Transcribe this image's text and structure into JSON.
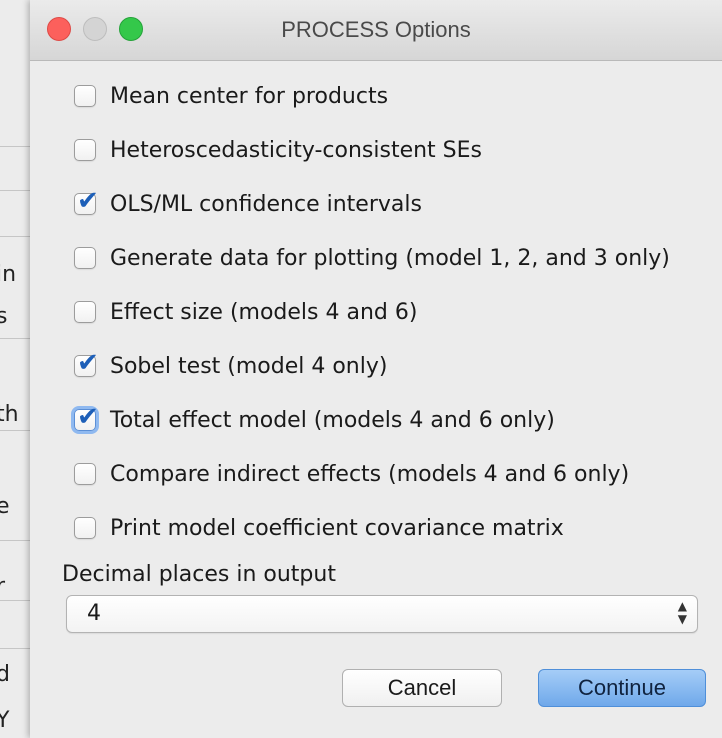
{
  "background_window": {
    "fragments": [
      "in",
      "s",
      "th",
      "e",
      "r",
      "d",
      "Y"
    ]
  },
  "dialog": {
    "title": "PROCESS Options",
    "options": [
      {
        "label": "Mean center for products",
        "checked": false
      },
      {
        "label": "Heteroscedasticity-consistent SEs",
        "checked": false
      },
      {
        "label": "OLS/ML confidence intervals",
        "checked": true
      },
      {
        "label": "Generate data for plotting (model 1, 2, and 3 only)",
        "checked": false
      },
      {
        "label": "Effect size (models 4 and 6)",
        "checked": false
      },
      {
        "label": "Sobel test (model 4 only)",
        "checked": true
      },
      {
        "label": "Total effect model (models 4 and 6 only)",
        "checked": true
      },
      {
        "label": "Compare indirect effects (models 4 and 6 only)",
        "checked": false
      },
      {
        "label": "Print model coefficient covariance matrix",
        "checked": false
      }
    ],
    "decimal_places": {
      "label": "Decimal places in output",
      "value": "4"
    },
    "buttons": {
      "cancel": "Cancel",
      "continue": "Continue"
    }
  },
  "icons": {
    "checkmark": "checkmark-icon",
    "select_arrows": "up-down-arrows-icon"
  },
  "colors": {
    "accent": "#1d5fb8",
    "close": "#fc605c",
    "zoom": "#34c84a",
    "default_button": "#6fa8ea"
  }
}
